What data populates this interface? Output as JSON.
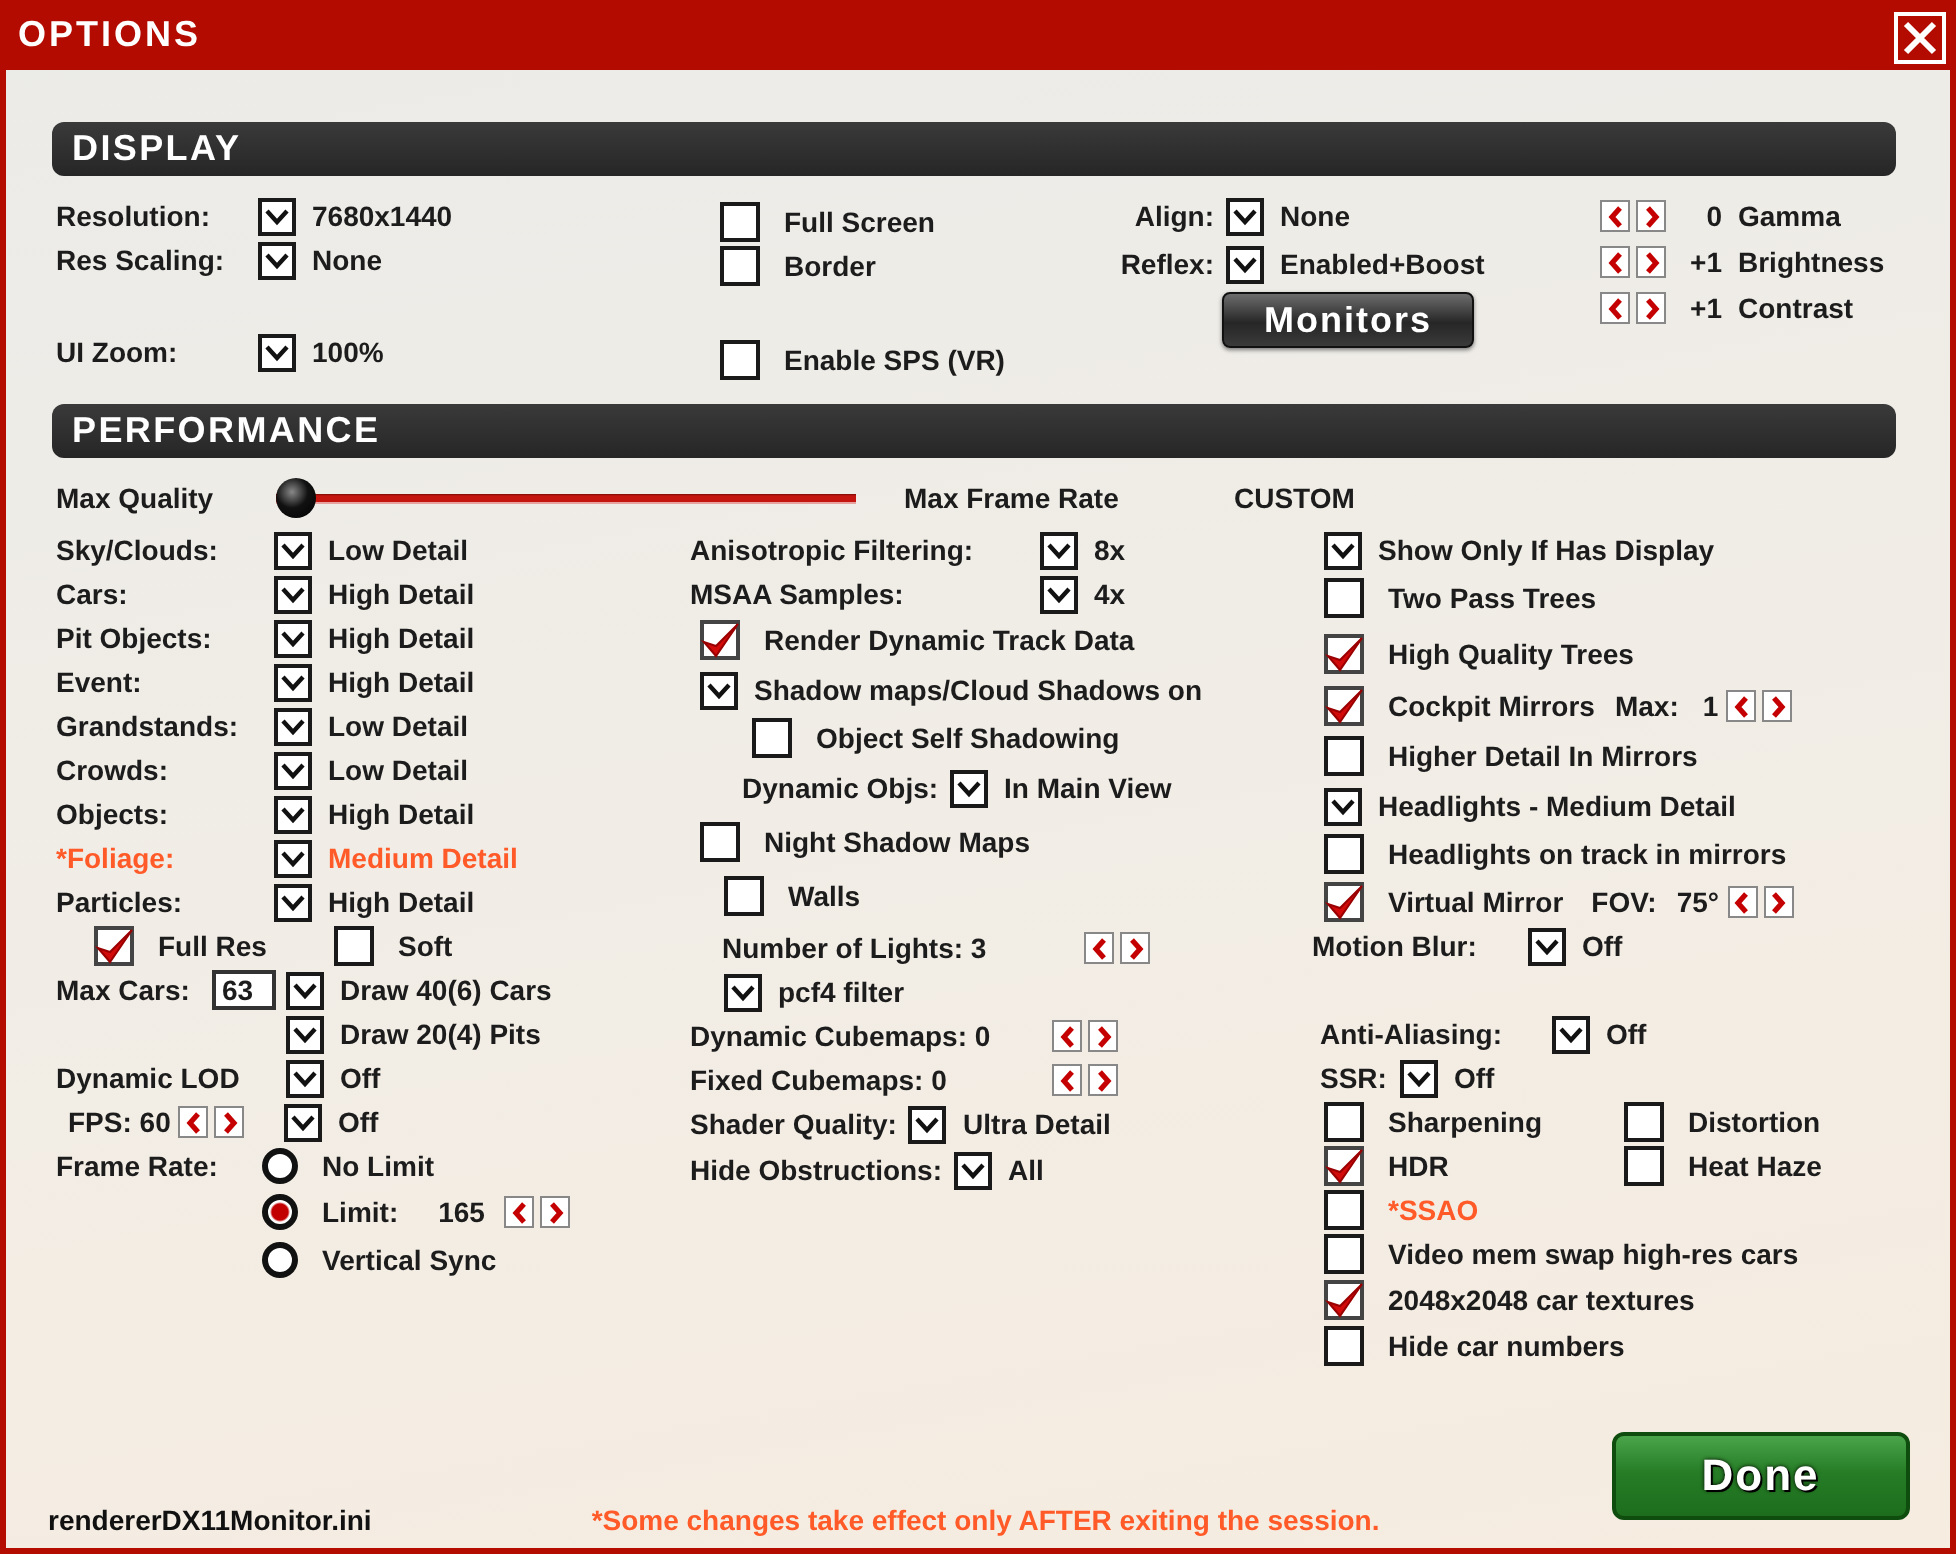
{
  "window": {
    "title": "OPTIONS"
  },
  "sections": [
    {
      "title": "DISPLAY",
      "columns": [
        {
          "rows": [
            {
              "items": [
                {
                  "kind": "label",
                  "text": "Resolution:"
                },
                {
                  "kind": "dropdown",
                  "value": "7680x1440"
                }
              ]
            },
            {
              "items": [
                {
                  "kind": "label",
                  "text": "Res Scaling:"
                },
                {
                  "kind": "dropdown",
                  "value": "None"
                }
              ]
            },
            {
              "items": [
                {
                  "kind": "label",
                  "text": "UI Zoom:"
                },
                {
                  "kind": "dropdown",
                  "value": "100%"
                }
              ]
            }
          ]
        },
        {
          "rows": [
            {
              "items": [
                {
                  "kind": "checkbox",
                  "label": "Full Screen",
                  "checked": false
                }
              ]
            },
            {
              "items": [
                {
                  "kind": "checkbox",
                  "label": "Border",
                  "checked": false
                }
              ]
            },
            {
              "items": [
                {
                  "kind": "checkbox",
                  "label": "Enable SPS (VR)",
                  "checked": false
                }
              ]
            }
          ]
        },
        {
          "rows": [
            {
              "items": [
                {
                  "kind": "label",
                  "text": "Align:"
                },
                {
                  "kind": "dropdown",
                  "value": "None"
                }
              ]
            },
            {
              "items": [
                {
                  "kind": "label",
                  "text": "Reflex:"
                },
                {
                  "kind": "dropdown",
                  "value": "Enabled+Boost"
                }
              ]
            }
          ],
          "button": "Monitors"
        },
        {
          "rows": [
            {
              "items": [
                {
                  "kind": "spinner"
                },
                {
                  "kind": "text",
                  "text": "0"
                },
                {
                  "kind": "text",
                  "text": "Gamma"
                }
              ]
            },
            {
              "items": [
                {
                  "kind": "spinner"
                },
                {
                  "kind": "text",
                  "text": "+1"
                },
                {
                  "kind": "text",
                  "text": "Brightness"
                }
              ]
            },
            {
              "items": [
                {
                  "kind": "spinner"
                },
                {
                  "kind": "text",
                  "text": "+1"
                },
                {
                  "kind": "text",
                  "text": "Contrast"
                }
              ]
            }
          ]
        }
      ]
    },
    {
      "title": "PERFORMANCE",
      "slider": {
        "label": "Max Quality",
        "level": 0,
        "end_label": "Max Frame Rate",
        "preset": "CUSTOM"
      },
      "columns": [
        {
          "rows": [
            {
              "items": [
                {
                  "kind": "label",
                  "text": "Sky/Clouds:"
                },
                {
                  "kind": "dropdown",
                  "value": "Low Detail"
                }
              ]
            },
            {
              "items": [
                {
                  "kind": "label",
                  "text": "Cars:"
                },
                {
                  "kind": "dropdown",
                  "value": "High Detail"
                }
              ]
            },
            {
              "items": [
                {
                  "kind": "label",
                  "text": "Pit Objects:"
                },
                {
                  "kind": "dropdown",
                  "value": "High Detail"
                }
              ]
            },
            {
              "items": [
                {
                  "kind": "label",
                  "text": "Event:"
                },
                {
                  "kind": "dropdown",
                  "value": "High Detail"
                }
              ]
            },
            {
              "items": [
                {
                  "kind": "label",
                  "text": "Grandstands:"
                },
                {
                  "kind": "dropdown",
                  "value": "Low Detail"
                }
              ]
            },
            {
              "items": [
                {
                  "kind": "label",
                  "text": "Crowds:"
                },
                {
                  "kind": "dropdown",
                  "value": "Low Detail"
                }
              ]
            },
            {
              "items": [
                {
                  "kind": "label",
                  "text": "Objects:"
                },
                {
                  "kind": "dropdown",
                  "value": "High Detail"
                }
              ]
            },
            {
              "items": [
                {
                  "kind": "label",
                  "text": "*Foliage:",
                  "color": "#ff5a28"
                },
                {
                  "kind": "dropdown",
                  "value": "Medium Detail",
                  "color": "#ff5a28"
                }
              ]
            },
            {
              "items": [
                {
                  "kind": "label",
                  "text": "Particles:"
                },
                {
                  "kind": "dropdown",
                  "value": "High Detail"
                }
              ]
            },
            {
              "items": [
                {
                  "kind": "checkbox",
                  "label": "Full Res",
                  "checked": true
                },
                {
                  "kind": "checkbox",
                  "label": "Soft",
                  "checked": false
                }
              ]
            },
            {
              "items": [
                {
                  "kind": "label",
                  "text": "Max Cars:"
                },
                {
                  "kind": "input",
                  "value": "63"
                },
                {
                  "kind": "dropdown",
                  "value": "Draw 40(6) Cars"
                }
              ]
            },
            {
              "items": [
                {
                  "kind": "dropdown",
                  "value": "Draw 20(4) Pits"
                }
              ]
            },
            {
              "items": [
                {
                  "kind": "label",
                  "text": "Dynamic LOD"
                },
                {
                  "kind": "dropdown",
                  "value": "Off"
                }
              ]
            },
            {
              "items": [
                {
                  "kind": "label",
                  "text": "FPS: 60"
                },
                {
                  "kind": "spinner"
                },
                {
                  "kind": "dropdown",
                  "value": "Off"
                }
              ]
            },
            {
              "items": [
                {
                  "kind": "label",
                  "text": "Frame Rate:"
                },
                {
                  "kind": "radio",
                  "label": "No Limit",
                  "selected": false
                }
              ]
            },
            {
              "items": [
                {
                  "kind": "radio",
                  "label": "Limit:",
                  "selected": true
                },
                {
                  "kind": "text",
                  "text": "165"
                },
                {
                  "kind": "spinner"
                }
              ]
            },
            {
              "items": [
                {
                  "kind": "radio",
                  "label": "Vertical Sync",
                  "selected": false
                }
              ]
            }
          ]
        },
        {
          "rows": [
            {
              "items": [
                {
                  "kind": "label",
                  "text": "Anisotropic Filtering:"
                },
                {
                  "kind": "dropdown",
                  "value": "8x"
                }
              ]
            },
            {
              "items": [
                {
                  "kind": "label",
                  "text": "MSAA Samples:"
                },
                {
                  "kind": "dropdown",
                  "value": "4x"
                }
              ]
            },
            {
              "items": [
                {
                  "kind": "checkbox",
                  "label": "Render Dynamic Track Data",
                  "checked": true
                }
              ]
            },
            {
              "items": [
                {
                  "kind": "dropdown",
                  "value": "Shadow maps/Cloud Shadows on"
                }
              ]
            },
            {
              "items": [
                {
                  "kind": "checkbox",
                  "label": "Object Self Shadowing",
                  "checked": false
                }
              ]
            },
            {
              "items": [
                {
                  "kind": "label",
                  "text": "Dynamic Objs:"
                },
                {
                  "kind": "dropdown",
                  "value": "In Main View"
                }
              ]
            },
            {
              "items": [
                {
                  "kind": "checkbox",
                  "label": "Night Shadow Maps",
                  "checked": false
                }
              ]
            },
            {
              "items": [
                {
                  "kind": "checkbox",
                  "label": "Walls",
                  "checked": false
                }
              ]
            },
            {
              "items": [
                {
                  "kind": "label",
                  "text": "Number of Lights: 3"
                },
                {
                  "kind": "spinner"
                }
              ]
            },
            {
              "items": [
                {
                  "kind": "dropdown",
                  "value": "pcf4 filter"
                }
              ]
            },
            {
              "items": [
                {
                  "kind": "label",
                  "text": "Dynamic Cubemaps: 0"
                },
                {
                  "kind": "spinner"
                }
              ]
            },
            {
              "items": [
                {
                  "kind": "label",
                  "text": "Fixed Cubemaps: 0"
                },
                {
                  "kind": "spinner"
                }
              ]
            },
            {
              "items": [
                {
                  "kind": "label",
                  "text": "Shader Quality:"
                },
                {
                  "kind": "dropdown",
                  "value": "Ultra Detail"
                }
              ]
            },
            {
              "items": [
                {
                  "kind": "label",
                  "text": "Hide Obstructions:"
                },
                {
                  "kind": "dropdown",
                  "value": "All"
                }
              ]
            }
          ]
        },
        {
          "rows": [
            {
              "items": [
                {
                  "kind": "dropdown",
                  "value": "Show Only If Has Display"
                }
              ]
            },
            {
              "items": [
                {
                  "kind": "checkbox",
                  "label": "Two Pass Trees",
                  "checked": false
                }
              ]
            },
            {
              "items": [
                {
                  "kind": "checkbox",
                  "label": "High Quality Trees",
                  "checked": true
                }
              ]
            },
            {
              "items": [
                {
                  "kind": "checkbox",
                  "label": "Cockpit Mirrors",
                  "checked": true
                },
                {
                  "kind": "text",
                  "text": "Max:"
                },
                {
                  "kind": "text",
                  "text": "1"
                },
                {
                  "kind": "spinner"
                }
              ]
            },
            {
              "items": [
                {
                  "kind": "checkbox",
                  "label": "Higher Detail In Mirrors",
                  "checked": false
                }
              ]
            },
            {
              "items": [
                {
                  "kind": "dropdown",
                  "value": "Headlights - Medium Detail"
                }
              ]
            },
            {
              "items": [
                {
                  "kind": "checkbox",
                  "label": "Headlights on track in mirrors",
                  "checked": false
                }
              ]
            },
            {
              "items": [
                {
                  "kind": "checkbox",
                  "label": "Virtual Mirror",
                  "checked": true
                },
                {
                  "kind": "text",
                  "text": "FOV:"
                },
                {
                  "kind": "text",
                  "text": "75°"
                },
                {
                  "kind": "spinner"
                }
              ]
            },
            {
              "items": [
                {
                  "kind": "label",
                  "text": "Motion Blur:"
                },
                {
                  "kind": "dropdown",
                  "value": "Off"
                }
              ]
            },
            {
              "items": [
                {
                  "kind": "label",
                  "text": "Anti-Aliasing:"
                },
                {
                  "kind": "dropdown",
                  "value": "Off"
                }
              ]
            },
            {
              "items": [
                {
                  "kind": "label",
                  "text": "SSR:"
                },
                {
                  "kind": "dropdown",
                  "value": "Off"
                }
              ]
            },
            {
              "items": [
                {
                  "kind": "checkbox",
                  "label": "Sharpening",
                  "checked": false
                },
                {
                  "kind": "checkbox",
                  "label": "Distortion",
                  "checked": false
                }
              ]
            },
            {
              "items": [
                {
                  "kind": "checkbox",
                  "label": "HDR",
                  "checked": true
                },
                {
                  "kind": "checkbox",
                  "label": "Heat Haze",
                  "checked": false
                }
              ]
            },
            {
              "items": [
                {
                  "kind": "checkbox",
                  "label": "*SSAO",
                  "checked": false,
                  "color": "#ff5a28"
                }
              ]
            },
            {
              "items": [
                {
                  "kind": "checkbox",
                  "label": "Video mem swap high-res cars",
                  "checked": false
                }
              ]
            },
            {
              "items": [
                {
                  "kind": "checkbox",
                  "label": "2048x2048 car textures",
                  "checked": true
                }
              ]
            },
            {
              "items": [
                {
                  "kind": "checkbox",
                  "label": "Hide car numbers",
                  "checked": false
                }
              ]
            }
          ]
        }
      ]
    }
  ],
  "footer": {
    "file": "rendererDX11Monitor.ini",
    "note": "*Some changes take effect only AFTER exiting the session."
  },
  "done_button": "Done"
}
